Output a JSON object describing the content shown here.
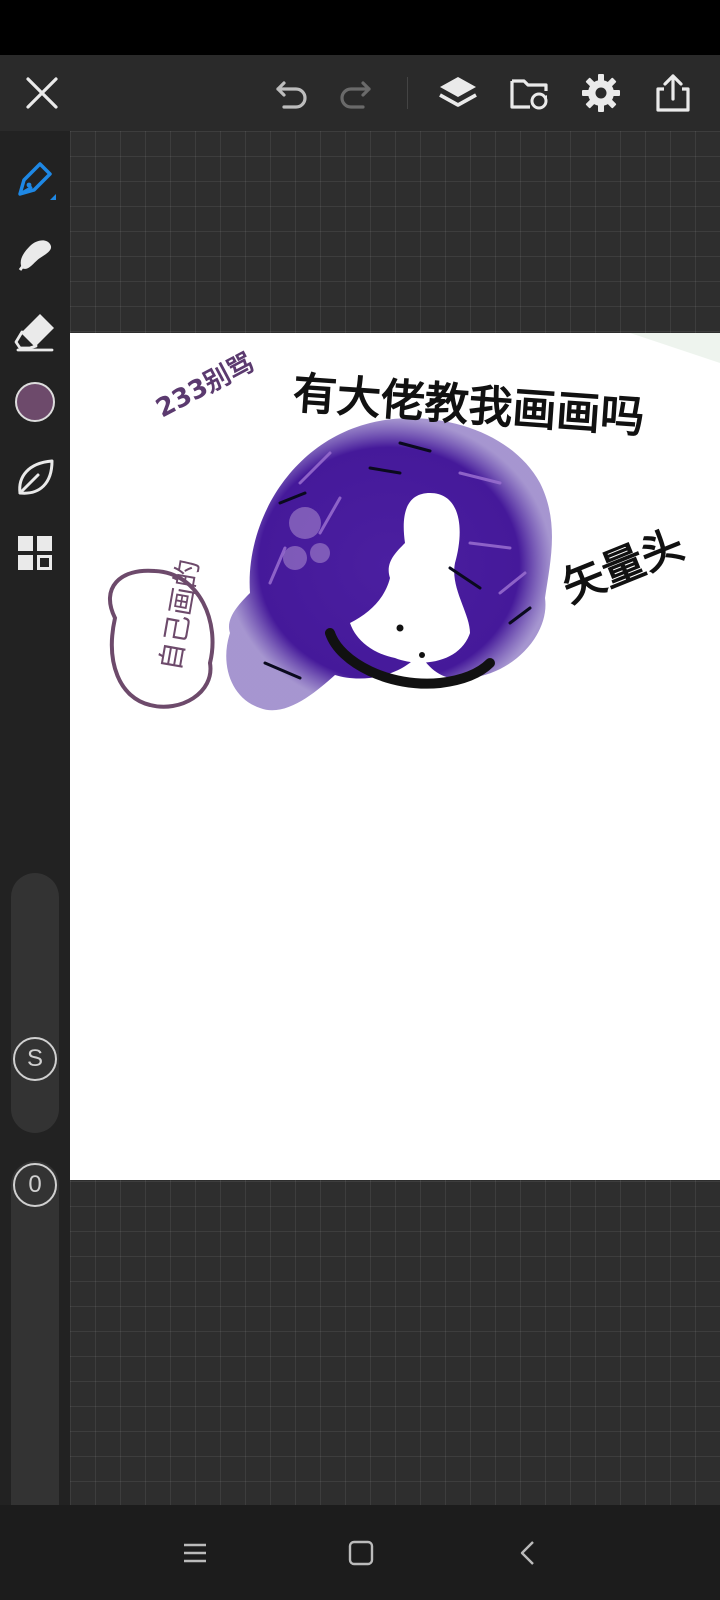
{
  "app": {
    "toolbar": {
      "icons": [
        "close-icon",
        "undo-icon",
        "redo-icon",
        "layers-icon",
        "gallery-icon",
        "settings-icon",
        "share-icon"
      ]
    },
    "sidebar": {
      "tools": [
        "brush-icon",
        "smudge-icon",
        "eraser-icon",
        "color-swatch",
        "leaf-shape-icon",
        "panels-icon"
      ],
      "active_tool": "brush",
      "active_color": "#6d4a6b",
      "size_slider_label": "S",
      "opacity_slider_label": "0"
    },
    "canvas": {
      "artwork_texts": [
        "有大佬教我画画吗",
        "233别骂",
        "矢量头",
        "自己画的"
      ]
    },
    "navbar": {
      "icons": [
        "menu-icon",
        "home-icon",
        "back-icon"
      ]
    }
  }
}
